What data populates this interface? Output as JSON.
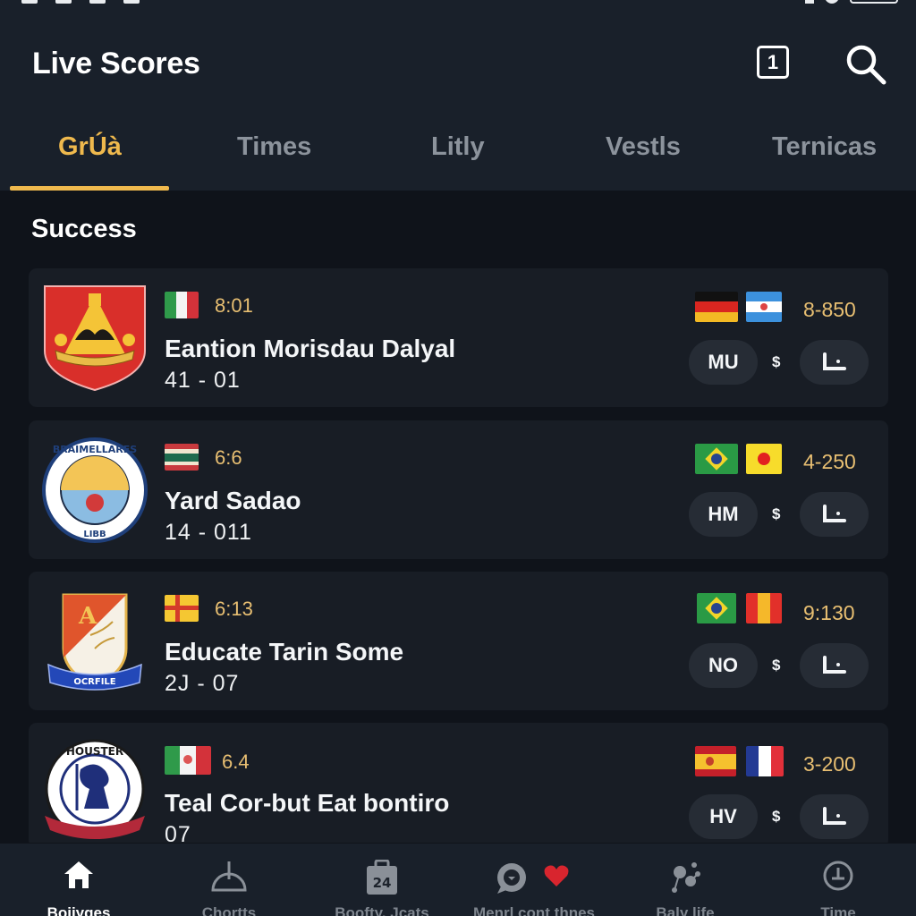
{
  "header": {
    "title": "Live Scores",
    "notification_badge": "1",
    "icons": {
      "notification": "badge-box-icon",
      "search": "search-icon"
    }
  },
  "tabs": [
    {
      "label": "GrÚà",
      "active": true
    },
    {
      "label": "Times",
      "active": false
    },
    {
      "label": "Litly",
      "active": false
    },
    {
      "label": "Vestls",
      "active": false
    },
    {
      "label": "Ternicas",
      "active": false
    }
  ],
  "section": {
    "title": "Success"
  },
  "matches": [
    {
      "crest": "red-shield-crest",
      "flag": "italy",
      "time": "8:01",
      "name": "Eantion Morisdau Dalyal",
      "score": "41 - 01",
      "flags_right": [
        "germany",
        "argentina"
      ],
      "odds": "8-850",
      "pill": "MU",
      "currency": "$"
    },
    {
      "crest": "round-blue-crest",
      "flag": "red-white-green-stripes",
      "time": "6:6",
      "name": "Yard Sadao",
      "score": "14 - 011",
      "flags_right": [
        "brazil",
        "yellow-red-dot"
      ],
      "odds": "4-250",
      "pill": "HM",
      "currency": "$"
    },
    {
      "crest": "orange-white-shield-crest",
      "flag": "yellow-red-cross",
      "time": "6:13",
      "name": "Educate Tarin Some",
      "score": "2J - 07",
      "flags_right": [
        "brazil",
        "red-yellow-vertical"
      ],
      "odds": "9:130",
      "pill": "NO",
      "currency": "$"
    },
    {
      "crest": "round-lion-crest",
      "flag": "mexico",
      "time": "6.4",
      "name": "Teal Cor-but Eat bontiro",
      "score": "07",
      "flags_right": [
        "spain",
        "france"
      ],
      "odds": "3-200",
      "pill": "HV",
      "currency": "$"
    }
  ],
  "bottom_nav": [
    {
      "label": "Bojiyges",
      "icon": "home-icon",
      "active": true
    },
    {
      "label": "Chortts",
      "icon": "dome-icon",
      "active": false
    },
    {
      "label": "Boofty, Jcats",
      "icon": "calendar-icon",
      "active": false
    },
    {
      "label": "Menrl cont thnes",
      "icon": "chat-heart-icon",
      "active": false
    },
    {
      "label": "Baly life",
      "icon": "molecule-icon",
      "active": false
    },
    {
      "label": "Time",
      "icon": "clock-icon",
      "active": false
    }
  ],
  "colors": {
    "accent": "#efb94d",
    "odds": "#e8bf72",
    "background": "#0f131a",
    "header": "#19202a",
    "card": "#181d25",
    "pill": "#262c35",
    "inactive_tab": "#8c939c"
  }
}
